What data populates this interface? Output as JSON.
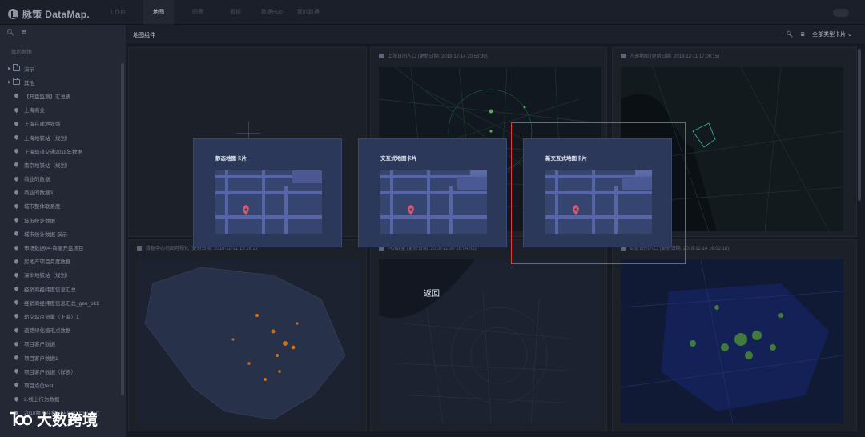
{
  "app": {
    "logo_text": "脉策 DataMap."
  },
  "nav": {
    "items": [
      {
        "label": "工作台",
        "active": false
      },
      {
        "label": "地图",
        "active": true
      },
      {
        "label": "图表",
        "active": false
      },
      {
        "label": "看板",
        "active": false
      },
      {
        "label": "数据Hub",
        "active": false
      },
      {
        "label": "我的数据",
        "active": false
      }
    ]
  },
  "sidebar": {
    "heading": "我的数据",
    "folders": [
      {
        "label": "演示"
      },
      {
        "label": "其他"
      }
    ],
    "items": [
      "【开盘监测】汇总表",
      "上海商业",
      "上海在建地铁站",
      "上海地铁站（规划）",
      "上海轨道交通2018年数据",
      "南京地铁站（规划）",
      "商业的数据",
      "商业的数据3",
      "城市整体联系度",
      "城市统计数据",
      "城市统计数据-演示",
      "市场数据04-商圈开盘项目",
      "房地产项目月度数据",
      "深圳地铁站（规划）",
      "经销商经纬度信息汇总",
      "经销商经纬度信息汇总_geo_ok1",
      "轨交站点流量（上海）1",
      "道路绿化植毛点数据",
      "项目客户数据",
      "项目客户数据1",
      "项目客户数据（样表）",
      "项目点位test",
      "2.线上行为数据",
      "2018魔方在租门店(1000mbuffer)"
    ]
  },
  "main": {
    "title": "地图组件",
    "filter_label": "全部类型卡片",
    "cards": [
      {
        "title": ""
      },
      {
        "title": "上海日间人口 (更新日期: 2018-12-14 20:53:30)"
      },
      {
        "title": "人途地图 (更新日期: 2018-12-11 17:06:15)"
      },
      {
        "title": "数据中心地图可视化 (更新日期: 2018-12-11 15:16:27)"
      },
      {
        "title": "POI数量 (更新日期: 2018-11-30 16:04:03)"
      },
      {
        "title": "街道日间人口 (更新日期: 2018-11-14 16:02:18)"
      }
    ]
  },
  "popover": {
    "options": [
      {
        "label": "静态地图卡片"
      },
      {
        "label": "交互式地图卡片"
      },
      {
        "label": "新交互式地图卡片"
      }
    ],
    "return_label": "返回"
  },
  "watermark": {
    "text": "大数跨境"
  },
  "colors": {
    "highlight": "#e03a3a",
    "popover_bg": "#2c3859",
    "map_road": "#5665a8",
    "pin": "#d9576a"
  }
}
